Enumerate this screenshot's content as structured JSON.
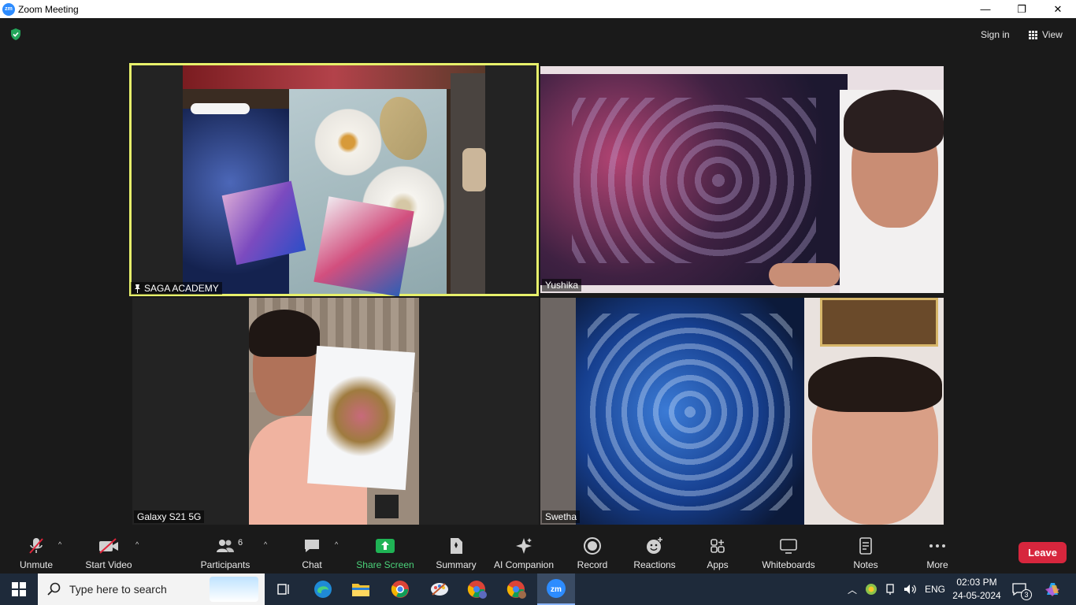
{
  "window": {
    "title": "Zoom Meeting",
    "logo_text": "zm",
    "controls": [
      "—",
      "❐",
      "✕"
    ]
  },
  "topbar": {
    "sign_in": "Sign in",
    "view": "View"
  },
  "tiles": [
    {
      "name": "SAGA ACADEMY",
      "active": true,
      "pinned": true
    },
    {
      "name": "Yushika"
    },
    {
      "name": "Galaxy S21 5G"
    },
    {
      "name": "Swetha"
    }
  ],
  "toolbar": {
    "unmute": "Unmute",
    "start_video": "Start Video",
    "participants": "Participants",
    "participants_count": "6",
    "chat": "Chat",
    "share_screen": "Share Screen",
    "summary": "Summary",
    "ai_companion": "AI Companion",
    "record": "Record",
    "reactions": "Reactions",
    "apps": "Apps",
    "whiteboards": "Whiteboards",
    "notes": "Notes",
    "more": "More",
    "leave": "Leave"
  },
  "taskbar": {
    "search_placeholder": "Type here to search",
    "language": "ENG",
    "time": "02:03 PM",
    "date": "24-05-2024",
    "notification_count": "3"
  },
  "colors": {
    "active_speaker": "#e7f06b",
    "share_green": "#1fb355",
    "leave_red": "#d7263d",
    "zoom_blue": "#2d8cff"
  }
}
